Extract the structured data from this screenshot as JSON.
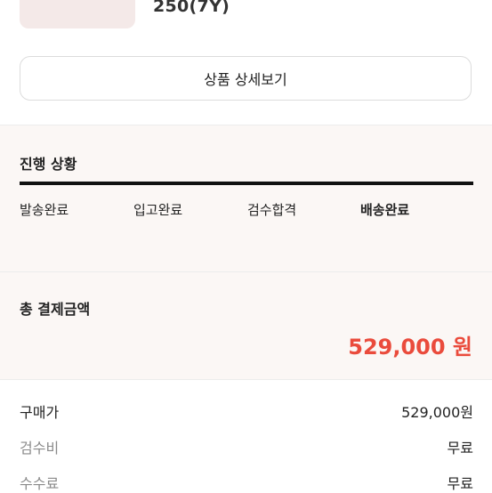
{
  "product": {
    "size_text": "250(7Y)"
  },
  "detail_button": {
    "label": "상품 상세보기"
  },
  "progress": {
    "title": "진행 상황",
    "steps": [
      {
        "label": "발송완료"
      },
      {
        "label": "입고완료"
      },
      {
        "label": "검수합격"
      },
      {
        "label": "배송완료"
      }
    ],
    "current_step": "배송완료"
  },
  "payment": {
    "total_label": "총 결제금액",
    "total_amount": "529,000 원",
    "accent_color": "#ea4b3c",
    "rows": [
      {
        "label": "구매가",
        "value": "529,000원"
      },
      {
        "label": "검수비",
        "value": "무료"
      },
      {
        "label": "수수료",
        "value": "무료"
      }
    ]
  }
}
